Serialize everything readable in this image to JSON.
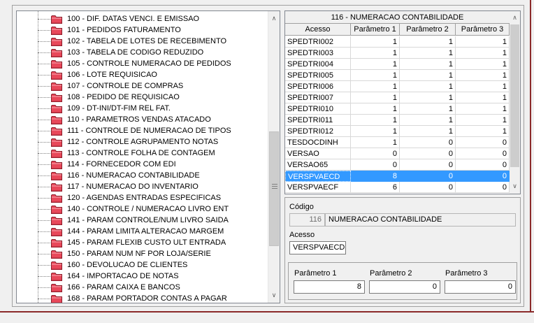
{
  "tree": {
    "items": [
      {
        "label": "100 - DIF. DATAS VENCI. E EMISSAO"
      },
      {
        "label": "101 - PEDIDOS FATURAMENTO"
      },
      {
        "label": "102 - TABELA DE LOTES DE RECEBIMENTO"
      },
      {
        "label": "103 - TABELA DE CODIGO REDUZIDO"
      },
      {
        "label": "105 - CONTROLE NUMERACAO DE PEDIDOS"
      },
      {
        "label": "106 - LOTE REQUISICAO"
      },
      {
        "label": "107 - CONTROLE DE COMPRAS"
      },
      {
        "label": "108 - PEDIDO DE REQUISICAO"
      },
      {
        "label": "109 - DT-INI/DT-FIM REL FAT."
      },
      {
        "label": "110 - PARAMETROS VENDAS ATACADO"
      },
      {
        "label": "111 - CONTROLE DE NUMERACAO DE TIPOS"
      },
      {
        "label": "112 - CONTROLE AGRUPAMENTO NOTAS"
      },
      {
        "label": "113 - CONTROLE FOLHA DE CONTAGEM"
      },
      {
        "label": "114 - FORNECEDOR COM EDI"
      },
      {
        "label": "116 - NUMERACAO CONTABILIDADE"
      },
      {
        "label": "117 - NUMERACAO DO INVENTARIO"
      },
      {
        "label": "120 - AGENDAS ENTRADAS ESPECIFICAS"
      },
      {
        "label": "140 - CONTROLE / NUMERACAO LIVRO ENT"
      },
      {
        "label": "141 - PARAM CONTROLE/NUM LIVRO SAIDA"
      },
      {
        "label": "144 - PARAM LIMITA ALTERACAO MARGEM"
      },
      {
        "label": "145 - PARAM FLEXIB CUSTO ULT ENTRADA"
      },
      {
        "label": "150 - PARAM NUM NF POR LOJA/SERIE"
      },
      {
        "label": "160 - DEVOLUCAO DE CLIENTES"
      },
      {
        "label": "164 - IMPORTACAO DE NOTAS"
      },
      {
        "label": "166 - PARAM CAIXA E BANCOS"
      },
      {
        "label": "168 - PARAM PORTADOR CONTAS A PAGAR"
      }
    ]
  },
  "grid": {
    "title": "116 - NUMERACAO CONTABILIDADE",
    "columns": [
      "Acesso",
      "Parâmetro 1",
      "Parâmetro 2",
      "Parâmetro 3"
    ],
    "rows": [
      [
        "SPEDTRI002",
        "1",
        "1",
        "1"
      ],
      [
        "SPEDTRI003",
        "1",
        "1",
        "1"
      ],
      [
        "SPEDTRI004",
        "1",
        "1",
        "1"
      ],
      [
        "SPEDTRI005",
        "1",
        "1",
        "1"
      ],
      [
        "SPEDTRI006",
        "1",
        "1",
        "1"
      ],
      [
        "SPEDTRI007",
        "1",
        "1",
        "1"
      ],
      [
        "SPEDTRI010",
        "1",
        "1",
        "1"
      ],
      [
        "SPEDTRI011",
        "1",
        "1",
        "1"
      ],
      [
        "SPEDTRI012",
        "1",
        "1",
        "1"
      ],
      [
        "TESDOCDINH",
        "1",
        "0",
        "0"
      ],
      [
        "VERSAO",
        "0",
        "0",
        "0"
      ],
      [
        "VERSAO65",
        "0",
        "0",
        "0"
      ],
      [
        "VERSPVAECD",
        "8",
        "0",
        "0"
      ],
      [
        "VERSPVAECF",
        "6",
        "0",
        "0"
      ]
    ],
    "selected_row": 12,
    "scroll_up": "∧",
    "scroll_down": "∨"
  },
  "detail": {
    "codigo_label": "Código",
    "codigo_value": "116",
    "codigo_desc": "NUMERACAO CONTABILIDADE",
    "acesso_label": "Acesso",
    "acesso_value": "VERSPVAECD",
    "param1_label": "Parâmetro 1",
    "param1_value": "8",
    "param2_label": "Parâmetro 2",
    "param2_value": "0",
    "param3_label": "Parâmetro 3",
    "param3_value": "0"
  },
  "tree_scroll": {
    "up": "∧",
    "down": "∨",
    "position": 0.42
  },
  "colors": {
    "selection": "#3399ff",
    "folder_fill": "#e8485a",
    "frame_accent": "#8b2a2a"
  }
}
